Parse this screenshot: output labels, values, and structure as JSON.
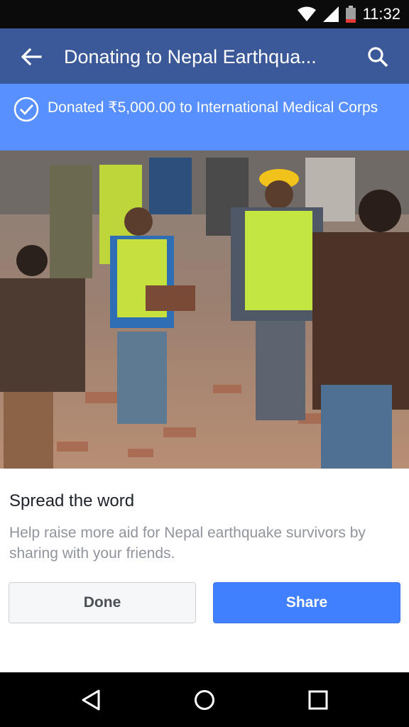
{
  "status_bar": {
    "time": "11:32"
  },
  "app_bar": {
    "title": "Donating to Nepal Earthqua..."
  },
  "banner": {
    "message": "Donated ₹5,000.00 to International Medical Corps"
  },
  "content": {
    "heading": "Spread the word",
    "description": "Help raise more aid for Nepal earthquake survivors by sharing with your friends."
  },
  "buttons": {
    "done_label": "Done",
    "share_label": "Share"
  },
  "colors": {
    "app_bar": "#3b5998",
    "banner": "#5890ff",
    "share_button": "#4080ff"
  },
  "icons": [
    "wifi-icon",
    "signal-icon",
    "battery-icon",
    "back-arrow-icon",
    "search-icon",
    "check-circle-icon",
    "nav-back-icon",
    "nav-home-icon",
    "nav-recents-icon"
  ]
}
